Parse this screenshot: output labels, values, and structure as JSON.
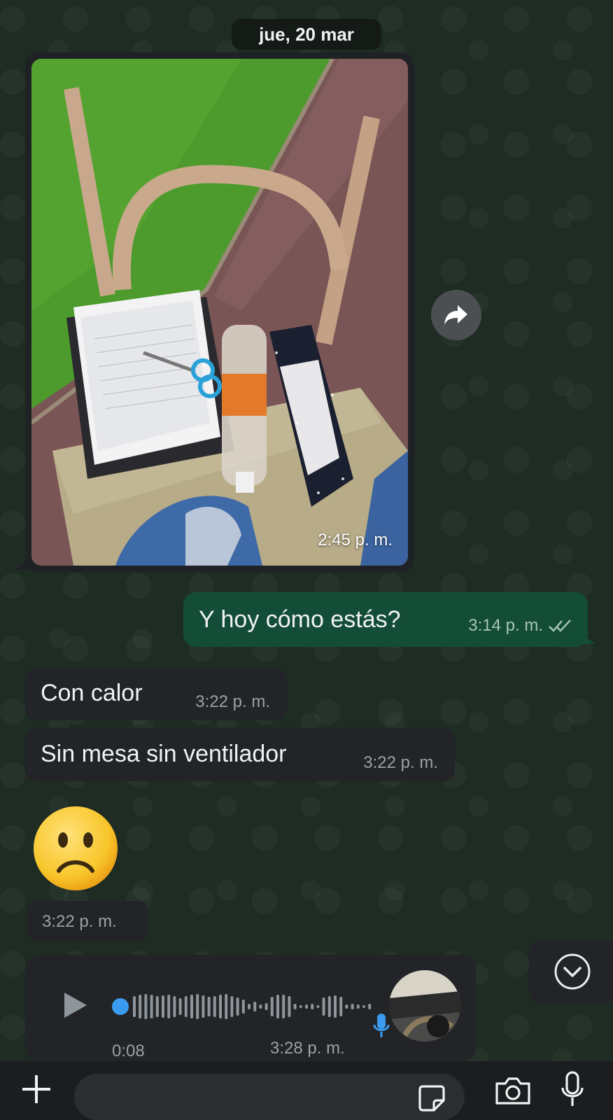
{
  "date_chip": "jue, 20 mar",
  "messages": {
    "image": {
      "time": "2:45 p. m."
    },
    "outgoing": {
      "text": "Y hoy cómo estás?",
      "time": "3:14 p. m."
    },
    "incoming1": {
      "text": "Con calor",
      "time": "3:22 p. m."
    },
    "incoming2": {
      "text": "Sin mesa sin ventilador",
      "time": "3:22 p. m."
    },
    "emoji": {
      "symbol": "🙁",
      "time": "3:22 p. m."
    },
    "voice": {
      "duration": "0:08",
      "time": "3:28 p. m.",
      "progress": 0
    }
  },
  "composer": {
    "placeholder": ""
  },
  "icons": {
    "forward": "forward-arrow-icon",
    "read_receipt": "double-check-icon",
    "play": "play-icon",
    "mic": "microphone-icon",
    "scroll": "chevron-down-icon",
    "plus": "plus-icon",
    "sticker": "sticker-icon",
    "camera": "camera-icon"
  },
  "colors": {
    "outgoing_bubble": "#144d37",
    "incoming_bubble": "#222427",
    "accent_blue": "#3b9bf0"
  }
}
